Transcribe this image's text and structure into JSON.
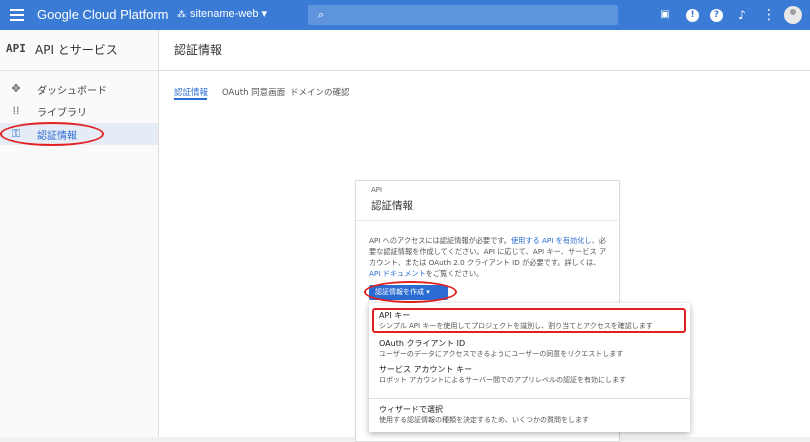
{
  "topbar": {
    "brand": "Google Cloud Platform",
    "project": "sitename-web",
    "project_icon": "project-dots-icon",
    "icons": [
      "cloud-shell-icon",
      "alert-icon",
      "help-icon",
      "notifications-icon",
      "account-icon"
    ],
    "color": "#3a7bd5"
  },
  "sidebar": {
    "api_badge": "API",
    "title": "API とサービス",
    "items": [
      {
        "label": "ダッシュボード",
        "icon": "dashboard-icon"
      },
      {
        "label": "ライブラリ",
        "icon": "library-icon"
      },
      {
        "label": "認証情報",
        "icon": "key-icon",
        "active": true
      }
    ]
  },
  "main": {
    "title": "認証情報",
    "tabs": [
      {
        "label": "認証情報",
        "active": true
      },
      {
        "label": "OAuth 同意画面"
      },
      {
        "label": "ドメインの確認"
      }
    ]
  },
  "card": {
    "subtitle": "API",
    "title": "認証情報",
    "text_part1": "API へのアクセスには認証情報が必要です。",
    "link1": "使用する API を有効化し",
    "text_part2": "、必要な認証情報を作成してください。API に応じて、API キー、サービス アカウント、または OAuth 2.0 クライアント ID が必要です。詳しくは、",
    "link2": "API ドキュメント",
    "text_part3": "をご覧ください。",
    "button": "認証情報を作成"
  },
  "menu": {
    "items": [
      {
        "title": "API キー",
        "desc": "シンプル API キーを使用してプロジェクトを識別し、割り当てとアクセスを確認します"
      },
      {
        "title": "OAuth クライアント ID",
        "desc": "ユーザーのデータにアクセスできるようにユーザーの同意をリクエストします"
      },
      {
        "title": "サービス アカウント キー",
        "desc": "ロボット アカウントによるサーバー間でのアプリレベルの認証を有効にします"
      },
      {
        "title": "ウィザードで選択",
        "desc": "使用する認証情報の種類を決定するため、いくつかの質問をします"
      }
    ]
  },
  "highlight_color": "#e32020"
}
